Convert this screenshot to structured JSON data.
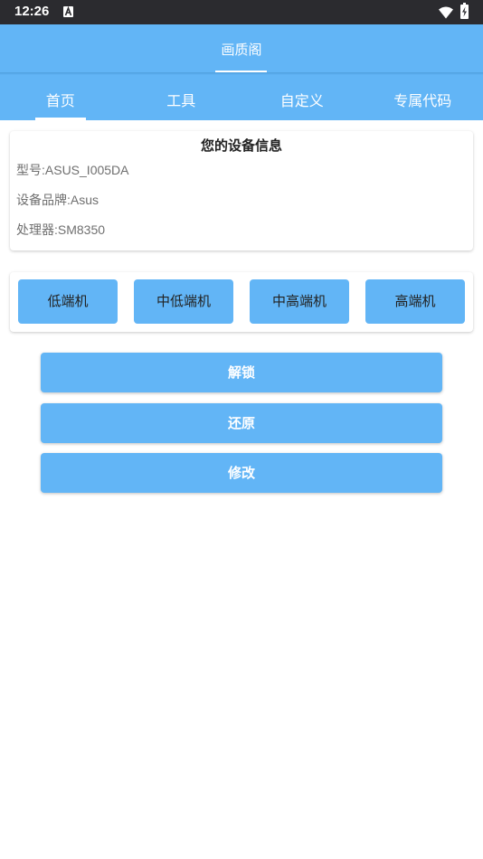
{
  "status_bar": {
    "time": "12:26",
    "icons": [
      "a-notification-icon",
      "wifi-icon",
      "battery-charging-icon"
    ]
  },
  "app_bar": {
    "title": "画质阁"
  },
  "tabs": [
    {
      "label": "首页",
      "selected": true
    },
    {
      "label": "工具",
      "selected": false
    },
    {
      "label": "自定义",
      "selected": false
    },
    {
      "label": "专属代码",
      "selected": false
    }
  ],
  "device_info": {
    "heading": "您的设备信息",
    "model": "型号:ASUS_I005DA",
    "brand": "设备品牌:Asus",
    "processor": "处理器:SM8350"
  },
  "tiers": [
    "低端机",
    "中低端机",
    "中高端机",
    "高端机"
  ],
  "actions": {
    "unlock": "解锁",
    "restore": "还原",
    "modify": "修改"
  },
  "colors": {
    "accent": "#62b5f6",
    "status_bar": "#2b2b2f",
    "text_dark": "#222222",
    "text_muted": "#6f6f6f"
  }
}
